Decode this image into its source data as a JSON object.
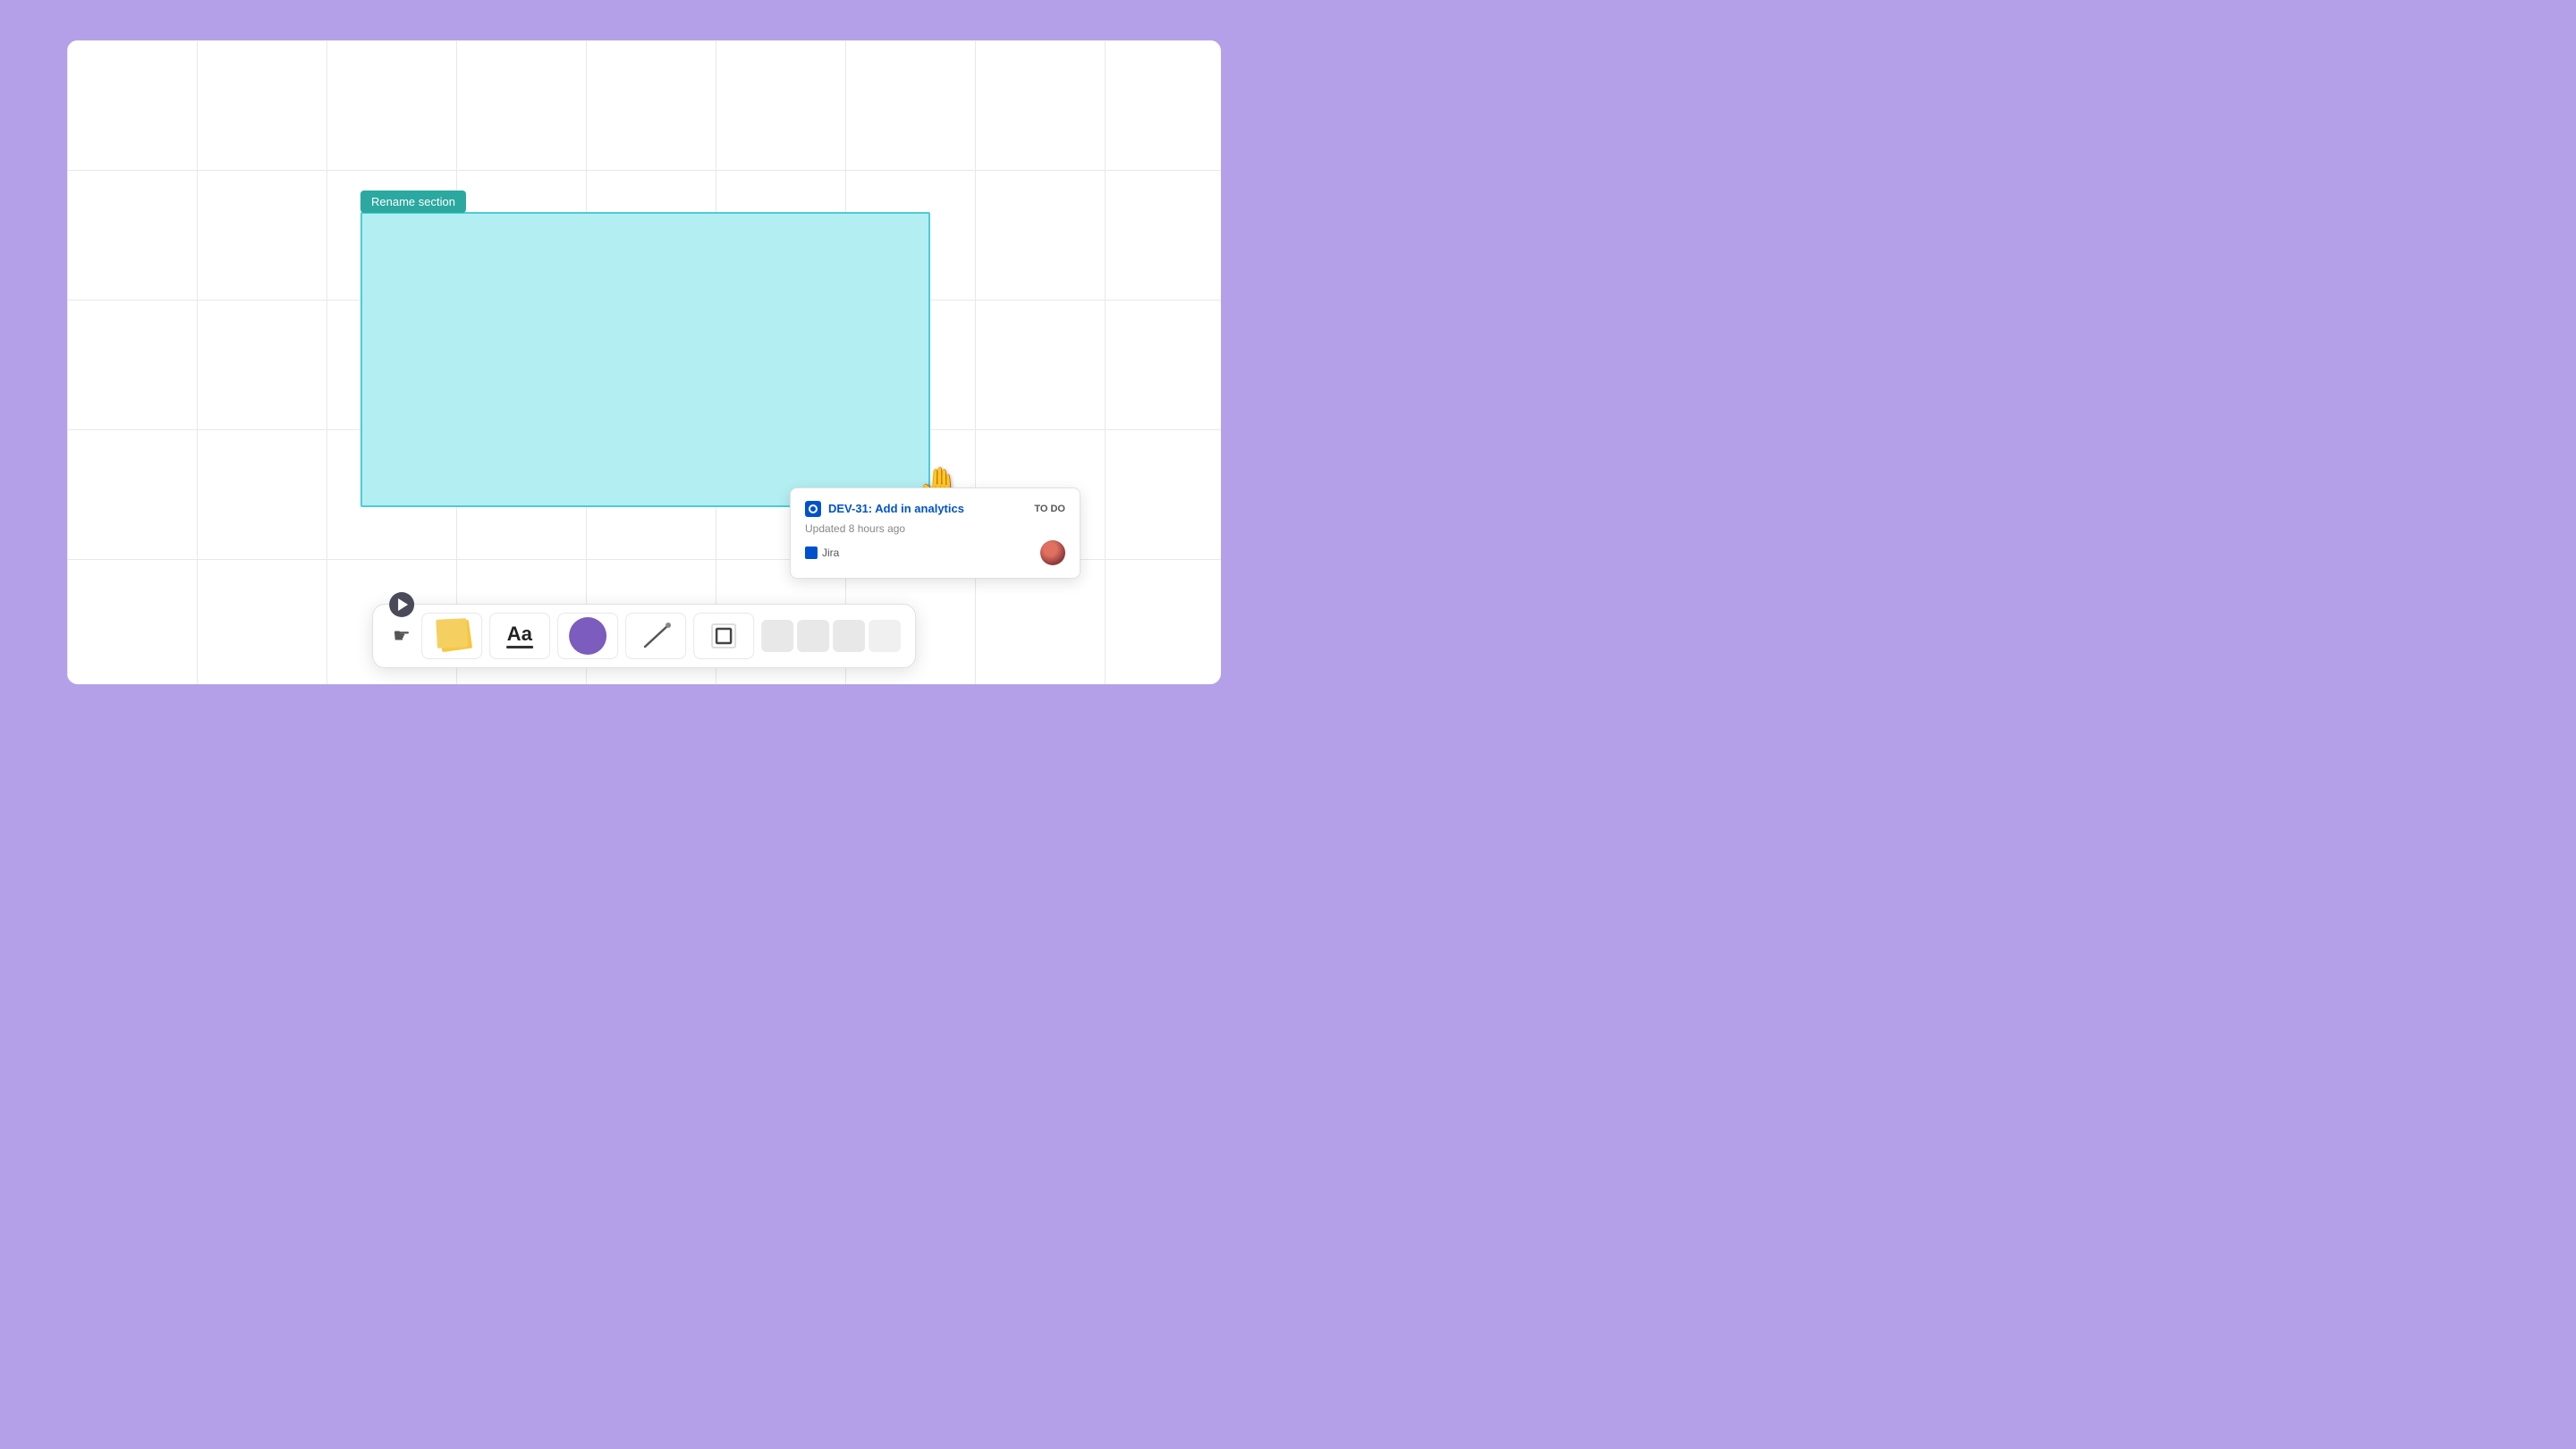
{
  "canvas": {
    "background": "#ffffff",
    "grid_color": "#e8e8e8"
  },
  "rename_section": {
    "label": "Rename section"
  },
  "card_popup": {
    "title": "DEV-31: Add in analytics",
    "status": "TO DO",
    "updated": "Updated 8 hours ago",
    "source": "Jira"
  },
  "toolbar": {
    "items": [
      {
        "id": "sticky-notes",
        "label": "Sticky Notes"
      },
      {
        "id": "text",
        "label": "Text"
      },
      {
        "id": "shapes",
        "label": "Shapes"
      },
      {
        "id": "line",
        "label": "Line"
      },
      {
        "id": "frame",
        "label": "Frame"
      }
    ],
    "play_button_label": "Play",
    "cursor_label": "Cursor"
  },
  "colors": {
    "teal_label": "#2ba8a0",
    "section_bg": "#b2eef2",
    "section_border": "#4dccd8",
    "purple_bg": "#b3a0e8",
    "jira_blue": "#0052cc",
    "shape_purple": "#7c5cbf"
  }
}
